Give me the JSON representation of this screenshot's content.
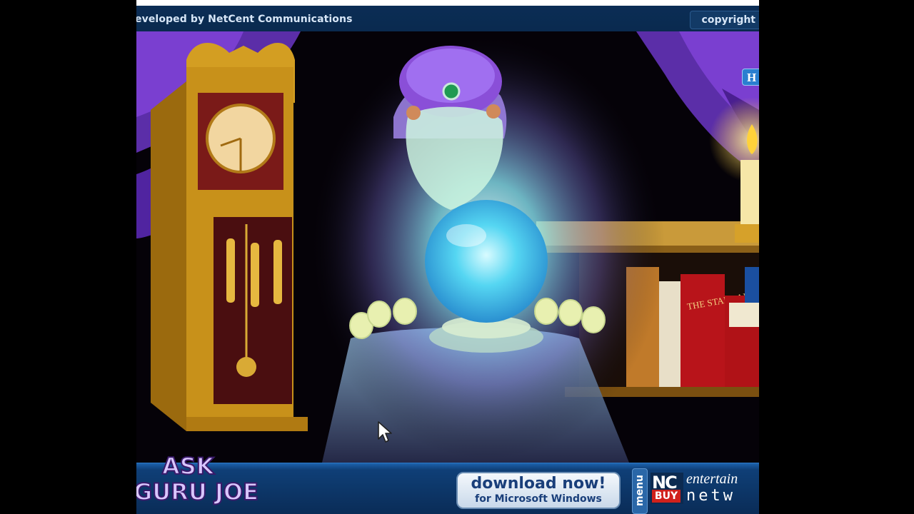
{
  "header": {
    "developer_text": "eveloped by NetCent Communications",
    "copyright_label": "copyright",
    "help_label": "H"
  },
  "footer": {
    "logo_line1": "ASK",
    "logo_line2": "GURU JOE",
    "download_main": "download now!",
    "download_sub": "for Microsoft Windows",
    "menu_label": "menu",
    "ng_label": "NC",
    "buy_label": "BUY",
    "entertain_label": "entertain",
    "network_label": "netw"
  },
  "scene": {
    "book_title": "THE STARS AND YOU"
  },
  "colors": {
    "bar_blue": "#0a2a4f",
    "curtain_purple": "#6a2bb8",
    "clock_gold": "#c8911a",
    "orb_glow": "#7fe6ff"
  },
  "icons": [
    "help-icon",
    "pointer-cursor-icon"
  ]
}
